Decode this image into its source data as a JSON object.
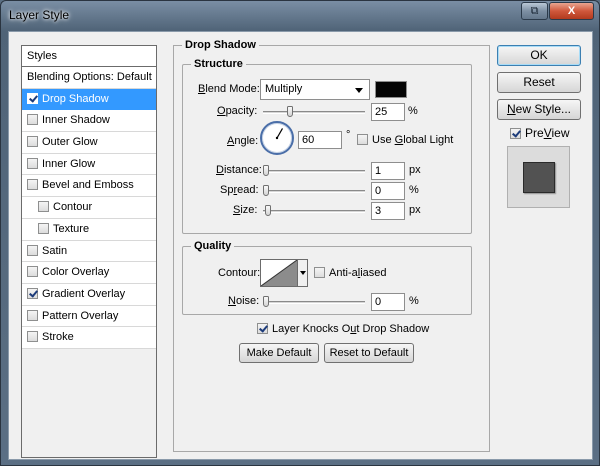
{
  "window": {
    "title": "Layer Style",
    "restore_glyph": "⧉",
    "close_glyph": "X"
  },
  "styles_panel": {
    "header": "Styles",
    "items": [
      {
        "label": "Blending Options: Default",
        "checkbox": false,
        "checked": false,
        "selected": false,
        "sub": false
      },
      {
        "label": "Drop Shadow",
        "checkbox": true,
        "checked": true,
        "selected": true,
        "sub": false
      },
      {
        "label": "Inner Shadow",
        "checkbox": true,
        "checked": false,
        "selected": false,
        "sub": false
      },
      {
        "label": "Outer Glow",
        "checkbox": true,
        "checked": false,
        "selected": false,
        "sub": false
      },
      {
        "label": "Inner Glow",
        "checkbox": true,
        "checked": false,
        "selected": false,
        "sub": false
      },
      {
        "label": "Bevel and Emboss",
        "checkbox": true,
        "checked": false,
        "selected": false,
        "sub": false
      },
      {
        "label": "Contour",
        "checkbox": true,
        "checked": false,
        "selected": false,
        "sub": true
      },
      {
        "label": "Texture",
        "checkbox": true,
        "checked": false,
        "selected": false,
        "sub": true
      },
      {
        "label": "Satin",
        "checkbox": true,
        "checked": false,
        "selected": false,
        "sub": false
      },
      {
        "label": "Color Overlay",
        "checkbox": true,
        "checked": false,
        "selected": false,
        "sub": false
      },
      {
        "label": "Gradient Overlay",
        "checkbox": true,
        "checked": true,
        "selected": false,
        "sub": false
      },
      {
        "label": "Pattern Overlay",
        "checkbox": true,
        "checked": false,
        "selected": false,
        "sub": false
      },
      {
        "label": "Stroke",
        "checkbox": true,
        "checked": false,
        "selected": false,
        "sub": false
      }
    ]
  },
  "drop_shadow": {
    "title": "Drop Shadow",
    "structure": {
      "title": "Structure",
      "blend_mode_label_u": "B",
      "blend_mode_label_rest": "lend Mode:",
      "blend_mode_value": "Multiply",
      "shadow_color": "#050505",
      "opacity_label_u": "O",
      "opacity_label_rest": "pacity:",
      "opacity_value": "25",
      "opacity_fraction": 0.25,
      "opacity_unit": "%",
      "angle_label_u": "A",
      "angle_label_rest": "ngle:",
      "angle_value": "60",
      "angle_unit": "°",
      "use_global_light_pre": "Use ",
      "use_global_light_u": "G",
      "use_global_light_rest": "lobal Light",
      "use_global_light_checked": false,
      "distance_label_u": "D",
      "distance_label_rest": "istance:",
      "distance_value": "1",
      "distance_fraction": 0.0,
      "distance_unit": "px",
      "spread_label_pre": "Sp",
      "spread_label_u": "r",
      "spread_label_rest": "ead:",
      "spread_value": "0",
      "spread_fraction": 0.0,
      "spread_unit": "%",
      "size_label_u": "S",
      "size_label_rest": "ize:",
      "size_value": "3",
      "size_fraction": 0.02,
      "size_unit": "px"
    },
    "quality": {
      "title": "Quality",
      "contour_label": "Contour:",
      "anti_aliased_pre": "Anti-a",
      "anti_aliased_u": "l",
      "anti_aliased_rest": "iased",
      "anti_aliased_checked": false,
      "noise_label_u": "N",
      "noise_label_rest": "oise:",
      "noise_value": "0",
      "noise_fraction": 0.0,
      "noise_unit": "%"
    },
    "knocks_out_pre": "Layer Knocks O",
    "knocks_out_u": "u",
    "knocks_out_rest": "t Drop Shadow",
    "knocks_out_checked": true,
    "make_default_label": "Make Default",
    "reset_default_label": "Reset to Default"
  },
  "actions": {
    "ok_label": "OK",
    "reset_label": "Reset",
    "new_style_u": "N",
    "new_style_rest": "ew Style...",
    "preview_label_u": "V",
    "preview_label_pre": "Pre",
    "preview_label_rest": "iew",
    "preview_checked": true
  }
}
